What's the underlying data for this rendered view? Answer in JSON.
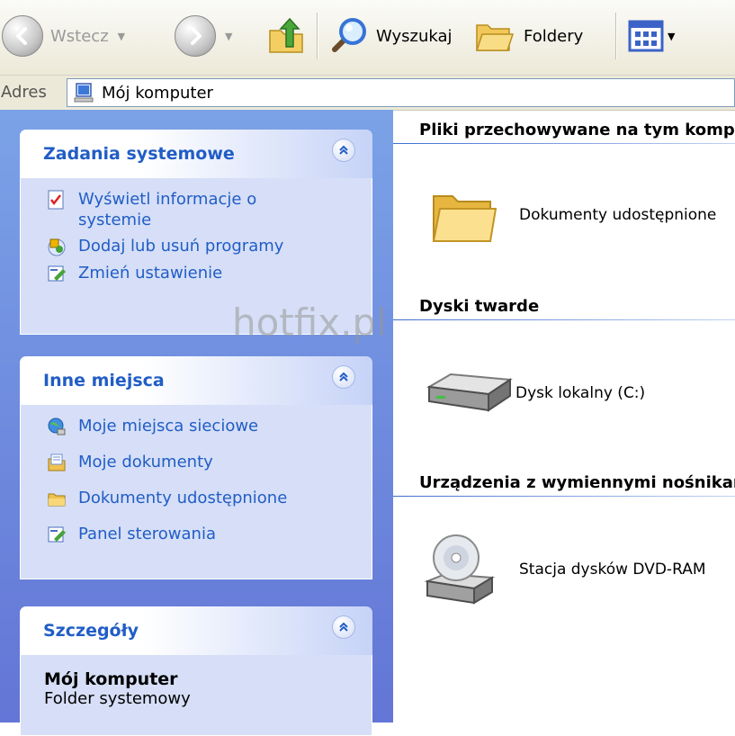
{
  "toolbar": {
    "back_label": "Wstecz",
    "search_label": "Wyszukaj",
    "folders_label": "Foldery"
  },
  "address": {
    "label": "Adres",
    "value": "Mój komputer"
  },
  "taskpane": {
    "system_tasks": {
      "title": "Zadania systemowe",
      "items": [
        {
          "label": "Wyświetl informacje o systemie",
          "icon": "system-info-icon"
        },
        {
          "label": "Dodaj lub usuń programy",
          "icon": "add-remove-programs-icon"
        },
        {
          "label": "Zmień ustawienie",
          "icon": "control-panel-icon"
        }
      ]
    },
    "other_places": {
      "title": "Inne miejsca",
      "items": [
        {
          "label": "Moje miejsca sieciowe",
          "icon": "network-places-icon"
        },
        {
          "label": "Moje dokumenty",
          "icon": "my-documents-icon"
        },
        {
          "label": "Dokumenty udostępnione",
          "icon": "shared-documents-icon"
        },
        {
          "label": "Panel sterowania",
          "icon": "control-panel-icon"
        }
      ]
    },
    "details": {
      "title": "Szczegóły",
      "name": "Mój komputer",
      "type": "Folder systemowy"
    }
  },
  "content": {
    "groups": [
      {
        "header": "Pliki przechowywane na tym komputerze",
        "items": [
          {
            "label": "Dokumenty udostępnione",
            "icon": "folder-icon"
          }
        ]
      },
      {
        "header": "Dyski twarde",
        "items": [
          {
            "label": "Dysk lokalny (C:)",
            "icon": "hard-drive-icon"
          }
        ]
      },
      {
        "header": "Urządzenia z wymiennymi nośnikami",
        "items": [
          {
            "label": "Stacja dysków DVD-RAM",
            "icon": "dvd-drive-icon"
          }
        ]
      }
    ]
  },
  "watermark": "hotfix.pl",
  "colors": {
    "taskpane_bg": "#7ba2e7",
    "task_link": "#215dc6",
    "panel_body": "#d6dff7"
  }
}
